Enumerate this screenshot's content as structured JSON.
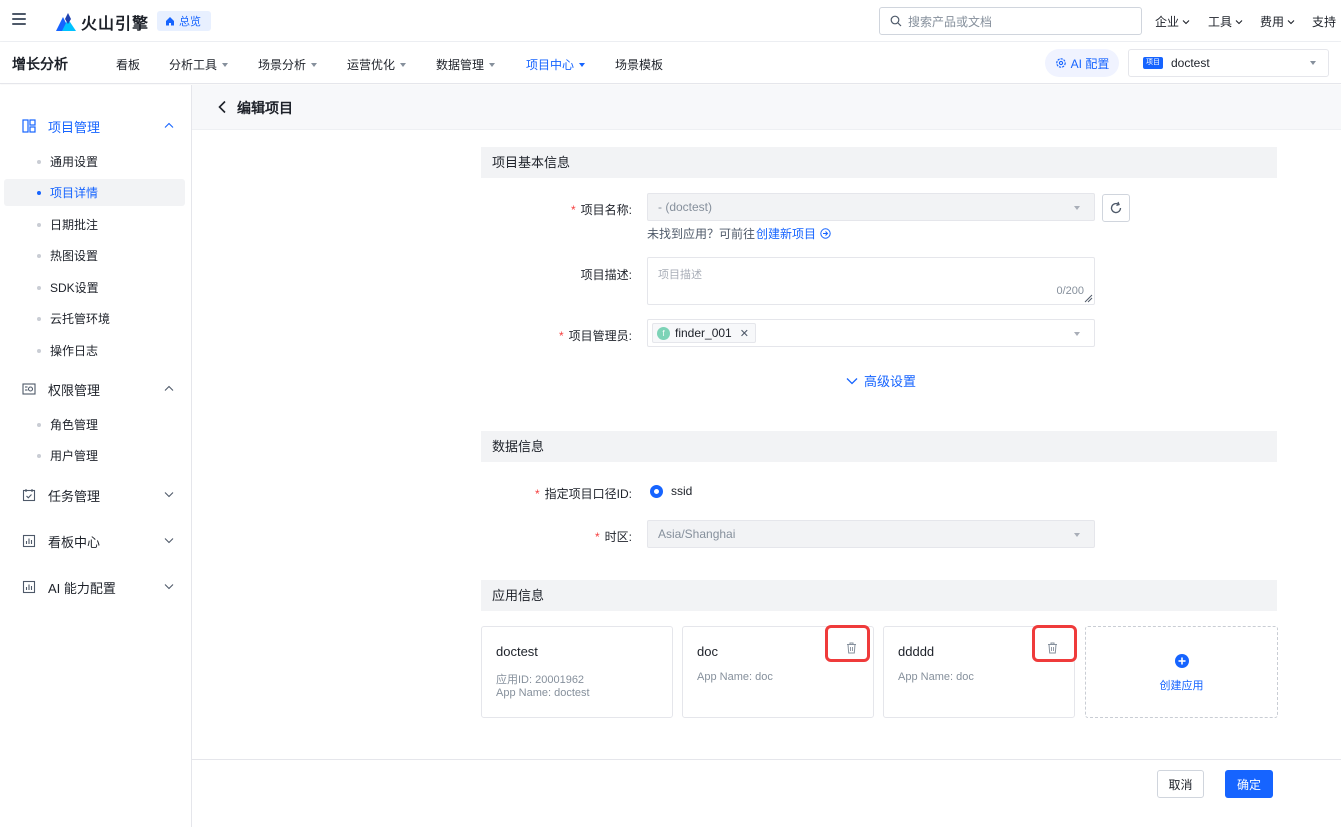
{
  "topbar": {
    "logo_text": "火山引擎",
    "overview_label": "总览",
    "search_placeholder": "搜索产品或文档",
    "menus": [
      "企业",
      "工具",
      "费用",
      "支持"
    ]
  },
  "navbar": {
    "brand": "增长分析",
    "items": [
      "看板",
      "分析工具",
      "场景分析",
      "运营优化",
      "数据管理",
      "项目中心",
      "场景模板"
    ],
    "active_item": "项目中心",
    "ai_label": "AI 配置",
    "project_badge": "项目",
    "project_name": "doctest"
  },
  "sidebar": {
    "groups": [
      {
        "label": "项目管理",
        "expanded": true,
        "active": true,
        "icon": "layout-icon",
        "items": [
          "通用设置",
          "项目详情",
          "日期批注",
          "热图设置",
          "SDK设置",
          "云托管环境",
          "操作日志"
        ]
      },
      {
        "label": "权限管理",
        "expanded": true,
        "icon": "permission-icon",
        "items": [
          "角色管理",
          "用户管理"
        ]
      },
      {
        "label": "任务管理",
        "expanded": false,
        "icon": "task-icon"
      },
      {
        "label": "看板中心",
        "expanded": false,
        "icon": "dashboard-icon"
      },
      {
        "label": "AI 能力配置",
        "expanded": false,
        "icon": "ai-config-icon"
      }
    ],
    "active_item": "项目详情"
  },
  "page": {
    "title": "编辑项目",
    "basic_section": "项目基本信息",
    "project_name_label": "项目名称:",
    "project_name_value": "- (doctest)",
    "hint_text": "未找到应用？可前往",
    "hint_link": "创建新项目",
    "desc_label": "项目描述:",
    "desc_placeholder": "项目描述",
    "desc_count": "0/200",
    "admin_label": "项目管理员:",
    "admin_tag": "finder_001",
    "admin_avatar": "f",
    "advanced_label": "高级设置",
    "data_section": "数据信息",
    "id_label": "指定项目口径ID:",
    "id_value": "ssid",
    "timezone_label": "时区:",
    "timezone_value": "Asia/Shanghai",
    "app_section": "应用信息",
    "apps": [
      {
        "name": "doctest",
        "id_line": "应用ID: 20001962",
        "app_name": "App Name: doctest"
      },
      {
        "name": "doc",
        "app_name": "App Name: doc"
      },
      {
        "name": "ddddd",
        "app_name": "App Name: doc"
      }
    ],
    "create_app": "创建应用",
    "cancel": "取消",
    "confirm": "确定"
  },
  "colors": {
    "accent": "#1664ff",
    "required": "#f53f3f",
    "highlight": "#ef3b3b"
  }
}
